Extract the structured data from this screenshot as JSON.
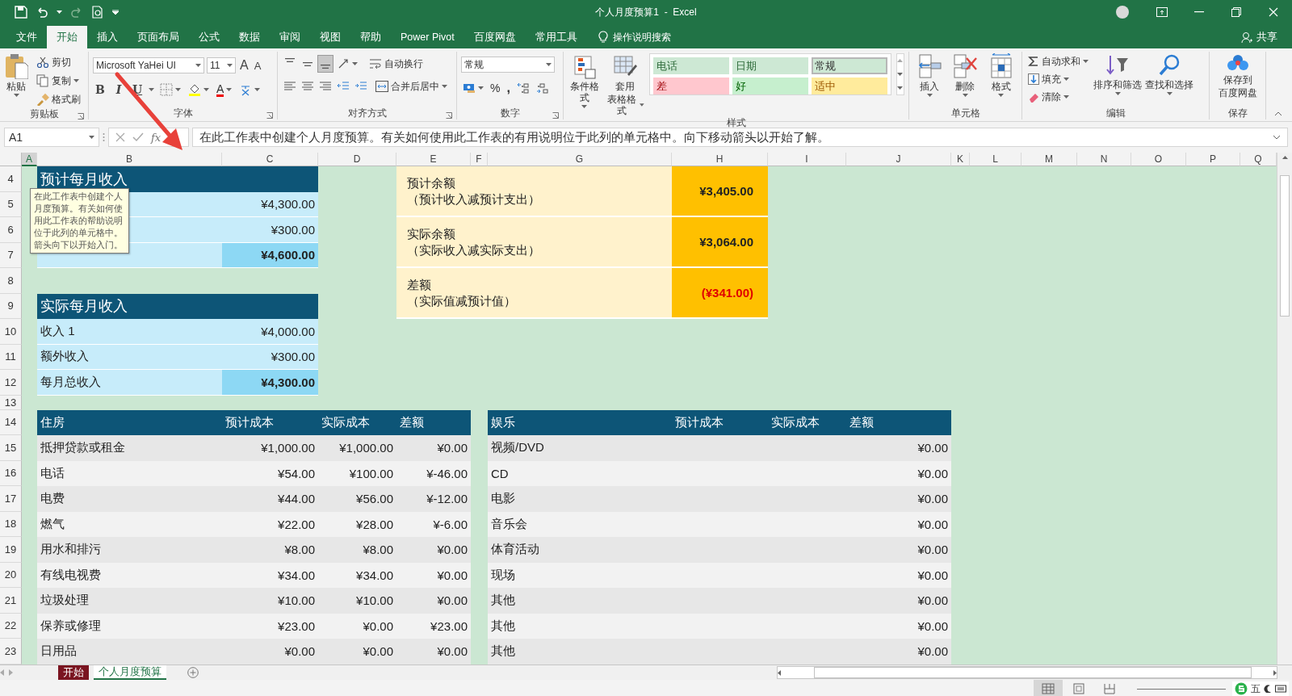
{
  "title_bar": {
    "title": "个人月度预算1  -  Excel"
  },
  "menu_tabs": [
    {
      "label": "文件",
      "selected": false
    },
    {
      "label": "开始",
      "selected": true
    },
    {
      "label": "插入",
      "selected": false
    },
    {
      "label": "页面布局",
      "selected": false
    },
    {
      "label": "公式",
      "selected": false
    },
    {
      "label": "数据",
      "selected": false
    },
    {
      "label": "审阅",
      "selected": false
    },
    {
      "label": "视图",
      "selected": false
    },
    {
      "label": "帮助",
      "selected": false
    },
    {
      "label": "Power Pivot",
      "selected": false
    },
    {
      "label": "百度网盘",
      "selected": false
    },
    {
      "label": "常用工具",
      "selected": false
    }
  ],
  "tell_me": {
    "placeholder": "操作说明搜索"
  },
  "share": "共享",
  "ribbon": {
    "clipboard": {
      "label": "剪贴板",
      "paste": "粘贴",
      "tools": [
        {
          "kind": "cut",
          "label": "剪切"
        },
        {
          "kind": "copy",
          "label": "复制"
        },
        {
          "kind": "painter",
          "label": "格式刷"
        }
      ]
    },
    "font": {
      "label": "字体",
      "font_name": "Microsoft YaHei UI",
      "font_size": "11",
      "grow": "A",
      "shrink": "A",
      "styles": [
        {
          "kind": "bold",
          "label": "B"
        },
        {
          "kind": "italic",
          "label": "I"
        },
        {
          "kind": "underline",
          "label": "U"
        }
      ],
      "font_color": "A"
    },
    "alignment": {
      "label": "对齐方式",
      "vertical": [
        {
          "selected": false
        },
        {
          "selected": false
        },
        {
          "selected": true
        }
      ],
      "wrap": "自动换行",
      "merge": "合并后居中"
    },
    "number": {
      "label": "数字",
      "format": "常规",
      "percent": "%",
      "comma": ","
    },
    "styles": {
      "label": "样式",
      "conditional": "条件格式",
      "table_format": [
        "套用",
        "表格格式"
      ],
      "cell_styles": [
        {
          "label": "电话",
          "kind": "custom",
          "color": "#cde8d4",
          "selected": false
        },
        {
          "label": "日期",
          "kind": "custom",
          "color": "#cde8d4",
          "selected": false
        },
        {
          "label": "常规",
          "kind": "normal",
          "color": "#cde8d4",
          "selected": true
        },
        {
          "label": "差",
          "kind": "bad",
          "color": "#ffc7ce",
          "selected": false
        },
        {
          "label": "好",
          "kind": "good",
          "color": "#c6efce",
          "selected": false
        },
        {
          "label": "适中",
          "kind": "neutral",
          "color": "#ffeb9c",
          "selected": false
        }
      ]
    },
    "cells": {
      "label": "单元格",
      "buttons": [
        {
          "kind": "insert",
          "label": "插入"
        },
        {
          "kind": "delete",
          "label": "删除"
        },
        {
          "kind": "format",
          "label": "格式"
        }
      ]
    },
    "editing": {
      "label": "编辑",
      "tools": [
        {
          "kind": "sum",
          "label": "自动求和"
        },
        {
          "kind": "fill",
          "label": "填充"
        },
        {
          "kind": "clear",
          "label": "清除"
        }
      ],
      "sort": "排序和筛选",
      "find": "查找和选择"
    },
    "save": {
      "label": "保存",
      "button": [
        "保存到",
        "百度网盘"
      ]
    }
  },
  "formula_bar": {
    "name_box": "A1",
    "function_label": "fx",
    "formula": "在此工作表中创建个人月度预算。有关如何使用此工作表的有用说明位于此列的单元格中。向下移动箭头以开始了解。"
  },
  "columns": [
    {
      "label": "A",
      "selected": true
    },
    {
      "label": "B",
      "selected": false
    },
    {
      "label": "C",
      "selected": false
    },
    {
      "label": "D",
      "selected": false
    },
    {
      "label": "E",
      "selected": false
    },
    {
      "label": "F",
      "selected": false
    },
    {
      "label": "G",
      "selected": false
    },
    {
      "label": "H",
      "selected": false
    },
    {
      "label": "I",
      "selected": false
    },
    {
      "label": "J",
      "selected": false
    },
    {
      "label": "K",
      "selected": false
    },
    {
      "label": "L",
      "selected": false
    },
    {
      "label": "M",
      "selected": false
    },
    {
      "label": "N",
      "selected": false
    },
    {
      "label": "O",
      "selected": false
    },
    {
      "label": "P",
      "selected": false
    },
    {
      "label": "Q",
      "selected": false
    }
  ],
  "row_numbers": [
    "4",
    "5",
    "6",
    "7",
    "8",
    "9",
    "10",
    "11",
    "12",
    "13",
    "14",
    "15",
    "16",
    "17",
    "18",
    "19",
    "20",
    "21",
    "22",
    "23"
  ],
  "planned_income": {
    "title": "预计每月收入",
    "rows": [
      {
        "value": "¥4,300.00",
        "kind": "item"
      },
      {
        "value": "¥300.00",
        "kind": "item"
      },
      {
        "value": "¥4,600.00",
        "kind": "total"
      }
    ]
  },
  "actual_income": {
    "title": "实际每月收入",
    "rows": [
      {
        "label": "收入 1",
        "value": "¥4,000.00",
        "kind": "item"
      },
      {
        "label": "额外收入",
        "value": "¥300.00",
        "kind": "item"
      },
      {
        "label": "每月总收入",
        "value": "¥4,300.00",
        "kind": "total"
      }
    ]
  },
  "balance": [
    {
      "label": "预计余额",
      "note": "（预计收入减预计支出）",
      "value": "¥3,405.00",
      "kind": "positive"
    },
    {
      "label": "实际余额",
      "note": "（实际收入减实际支出）",
      "value": "¥3,064.00",
      "kind": "positive"
    },
    {
      "label": "差额",
      "note": "（实际值减预计值）",
      "value": "(¥341.00)",
      "kind": "negative"
    }
  ],
  "housing": {
    "columns": [
      "住房",
      "预计成本",
      "实际成本",
      "差额"
    ],
    "rows": [
      {
        "item": "抵押贷款或租金",
        "planned": "¥1,000.00",
        "actual": "¥1,000.00",
        "difference": "¥0.00"
      },
      {
        "item": "电话",
        "planned": "¥54.00",
        "actual": "¥100.00",
        "difference": "¥-46.00"
      },
      {
        "item": "电费",
        "planned": "¥44.00",
        "actual": "¥56.00",
        "difference": "¥-12.00"
      },
      {
        "item": "燃气",
        "planned": "¥22.00",
        "actual": "¥28.00",
        "difference": "¥-6.00"
      },
      {
        "item": "用水和排污",
        "planned": "¥8.00",
        "actual": "¥8.00",
        "difference": "¥0.00"
      },
      {
        "item": "有线电视费",
        "planned": "¥34.00",
        "actual": "¥34.00",
        "difference": "¥0.00"
      },
      {
        "item": "垃圾处理",
        "planned": "¥10.00",
        "actual": "¥10.00",
        "difference": "¥0.00"
      },
      {
        "item": "保养或修理",
        "planned": "¥23.00",
        "actual": "¥0.00",
        "difference": "¥23.00"
      },
      {
        "item": "日用品",
        "planned": "¥0.00",
        "actual": "¥0.00",
        "difference": "¥0.00"
      }
    ]
  },
  "entertainment": {
    "columns": [
      "娱乐",
      "预计成本",
      "实际成本",
      "差额"
    ],
    "rows": [
      {
        "item": "视频/DVD",
        "difference": "¥0.00"
      },
      {
        "item": "CD",
        "difference": "¥0.00"
      },
      {
        "item": "电影",
        "difference": "¥0.00"
      },
      {
        "item": "音乐会",
        "difference": "¥0.00"
      },
      {
        "item": "体育活动",
        "difference": "¥0.00"
      },
      {
        "item": "现场",
        "difference": "¥0.00"
      },
      {
        "item": "其他",
        "difference": "¥0.00"
      },
      {
        "item": "其他",
        "difference": "¥0.00"
      },
      {
        "item": "其他",
        "difference": "¥0.00"
      }
    ]
  },
  "tooltip": "在此工作表中创建个人月度预算。有关如何使用此工作表的帮助说明位于此列的单元格中。箭头向下以开始入门。",
  "sheet_tabs": [
    {
      "label": "开始",
      "selected": false,
      "color": "#7a1420"
    },
    {
      "label": "个人月度预算",
      "selected": true
    }
  ],
  "status_bar": {
    "views": [
      {
        "kind": "normal",
        "selected": true
      },
      {
        "kind": "page_layout",
        "selected": false
      },
      {
        "kind": "page_break",
        "selected": false
      }
    ],
    "ime": "五"
  }
}
